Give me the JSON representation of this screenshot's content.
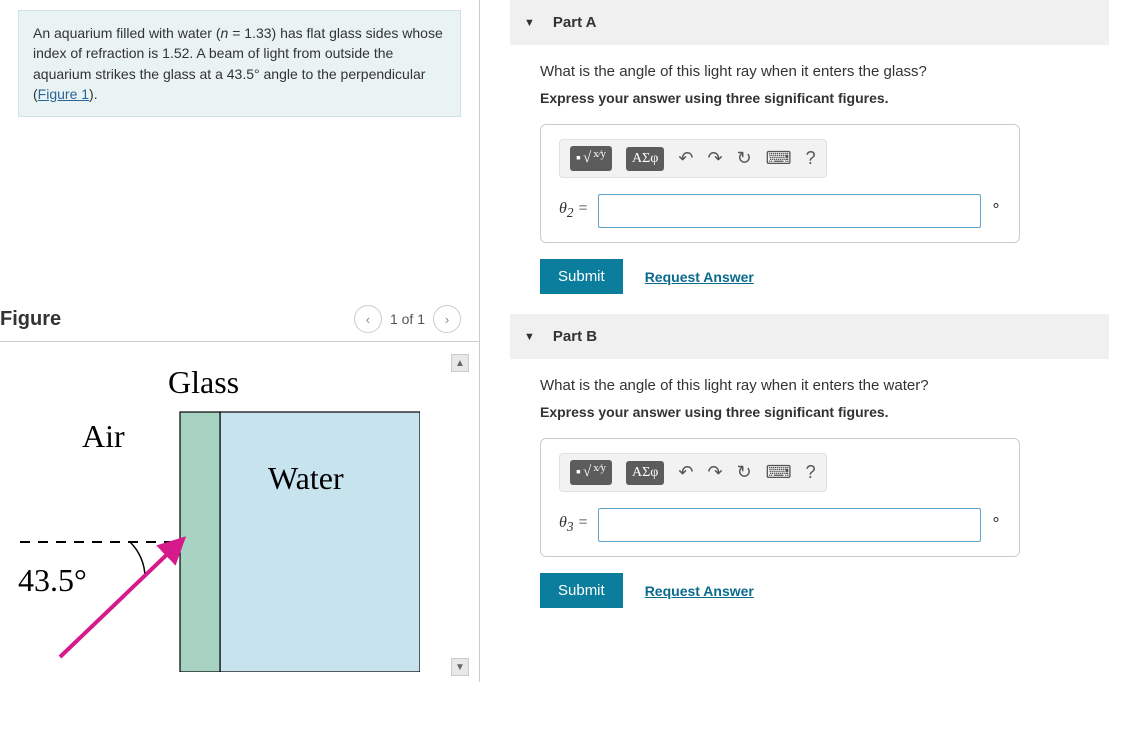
{
  "problem": {
    "text_pre": "An aquarium filled with water (",
    "n_symbol": "n",
    "equals": " = 1.33) has flat glass sides whose index of refraction is 1.52. A beam of light from outside the aquarium strikes the glass at a 43.5° angle to the perpendicular (",
    "figure_link": "Figure 1",
    "text_post": ")."
  },
  "figure": {
    "title": "Figure",
    "pager": "1 of 1",
    "labels": {
      "glass": "Glass",
      "air": "Air",
      "water": "Water",
      "angle": "43.5°"
    }
  },
  "parts": [
    {
      "header": "Part A",
      "question": "What is the angle of this light ray when it enters the glass?",
      "instruction": "Express your answer using three significant figures.",
      "symbols_btn": "ΑΣφ",
      "var_html": "θ<sub>2</sub> =",
      "unit": "∘",
      "submit": "Submit",
      "request": "Request Answer"
    },
    {
      "header": "Part B",
      "question": "What is the angle of this light ray when it enters the water?",
      "instruction": "Express your answer using three significant figures.",
      "symbols_btn": "ΑΣφ",
      "var_html": "θ<sub>3</sub> =",
      "unit": "∘",
      "submit": "Submit",
      "request": "Request Answer"
    }
  ]
}
